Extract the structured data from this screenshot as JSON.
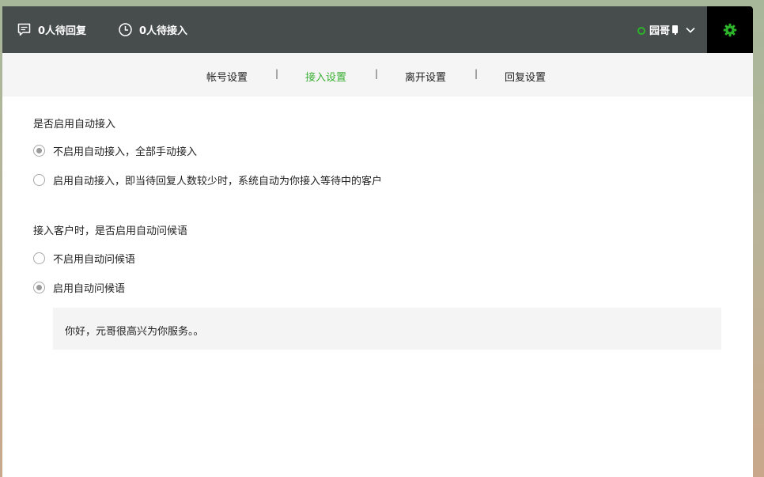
{
  "header": {
    "pending_reply": "0人待回复",
    "pending_accept": "0人待接入",
    "user_name": "园哥",
    "colors": {
      "bar": "#474d4d",
      "accent": "#2db32a",
      "settings_bg": "#000000"
    },
    "icons": {
      "reply": "chat-bubble-icon",
      "accept": "clock-icon",
      "status": "online-status-icon",
      "device": "device-icon",
      "dropdown": "chevron-down-icon",
      "settings": "gear-icon"
    }
  },
  "tabs": [
    {
      "label": "帐号设置",
      "active": false
    },
    {
      "label": "接入设置",
      "active": true
    },
    {
      "label": "离开设置",
      "active": false
    },
    {
      "label": "回复设置",
      "active": false
    }
  ],
  "tab_separator": "|",
  "auto_accept": {
    "title": "是否启用自动接入",
    "options": [
      {
        "label": "不启用自动接入，全部手动接入",
        "checked": true
      },
      {
        "label": "启用自动接入，即当待回复人数较少时，系统自动为你接入等待中的客户",
        "checked": false
      }
    ]
  },
  "auto_greeting": {
    "title": "接入客户时，是否启用自动问候语",
    "options": [
      {
        "label": "不启用自动问候语",
        "checked": false
      },
      {
        "label": "启用自动问候语",
        "checked": true
      }
    ],
    "message": "你好，元哥很高兴为你服务。。"
  }
}
